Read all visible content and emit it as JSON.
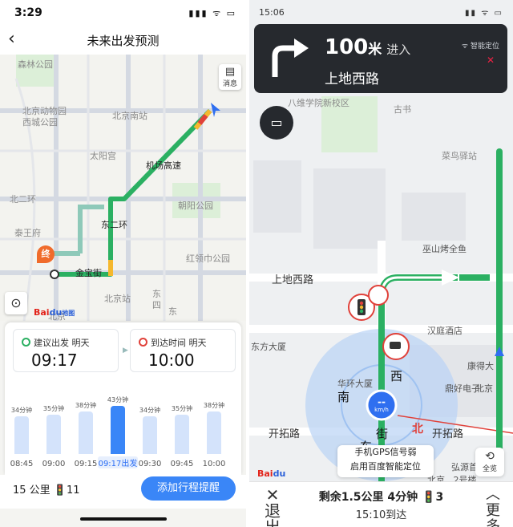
{
  "left": {
    "status": {
      "time": "3:29",
      "location_icon": "location-arrow-icon",
      "icons": "▮▮▮ ᯤ ▭"
    },
    "header": {
      "back": "‹",
      "title": "未来出发预测"
    },
    "map": {
      "labels": [
        "森林公园",
        "北京动物园",
        "北京南站",
        "西城公园",
        "北二环",
        "太阳宫",
        "朝阳公园",
        "泰王府",
        "红领巾公园",
        "金宝街",
        "北京站",
        "东二环",
        "机场高速",
        "东",
        "四",
        "东",
        "北京"
      ],
      "dest_marker": "终",
      "msg_label": "消息",
      "logo_a": "Bai",
      "logo_b": "du",
      "logo_c": "地图"
    },
    "depart": {
      "label": "建议出发 明天",
      "time": "09:17"
    },
    "arrive": {
      "label": "到达时间 明天",
      "time": "10:00"
    },
    "bars": [
      {
        "time": "08:45",
        "value": 34,
        "label": "34分钟"
      },
      {
        "time": "09:00",
        "value": 35,
        "label": "35分钟"
      },
      {
        "time": "09:15",
        "value": 38,
        "label": "38分钟"
      },
      {
        "time": "09:17出发",
        "value": 43,
        "label": "43分钟",
        "selected": true
      },
      {
        "time": "09:30",
        "value": 34,
        "label": "34分钟"
      },
      {
        "time": "09:45",
        "value": 35,
        "label": "35分钟"
      },
      {
        "time": "10:00",
        "value": 38,
        "label": "38分钟"
      }
    ],
    "footer": {
      "distance": "15 公里",
      "lights": "11",
      "cta": "添加行程提醒"
    }
  },
  "right": {
    "status": {
      "time": "15:06",
      "icons": "▮▮ ᯤ ▭"
    },
    "nav": {
      "distance": "100",
      "unit": "米",
      "action": "进入",
      "road": "上地西路",
      "smart": "智能定位",
      "signal": "✕"
    },
    "map": {
      "labels": [
        "八维学院新校区",
        "古书",
        "菜鸟驿站",
        "巫山烤全鱼",
        "上地西路",
        "汉庭酒店",
        "华环大厦",
        "东方大厦",
        "鼎好电子",
        "开拓路",
        "开拓路",
        "弘源首",
        "北京...2号楼",
        "康得大",
        "北京",
        "西",
        "南",
        "街",
        "东",
        "北"
      ],
      "speed_unit": "km/h",
      "speed_value": "--",
      "gps_line1": "手机GPS信号弱",
      "gps_line2": "启用百度智能定位",
      "full_label": "全览",
      "logo_a": "Bai",
      "logo_b": "du"
    },
    "bottom": {
      "exit": "退出",
      "remain": "剩余1.5公里 4分钟",
      "lights": "3",
      "arrive": "15:10到达",
      "more": "更多"
    }
  },
  "colors": {
    "route": "#2bb062",
    "route_slow": "#f5b82e",
    "route_jam": "#e0413a",
    "accent": "#3a86f7",
    "nav_bg": "#26292e"
  }
}
